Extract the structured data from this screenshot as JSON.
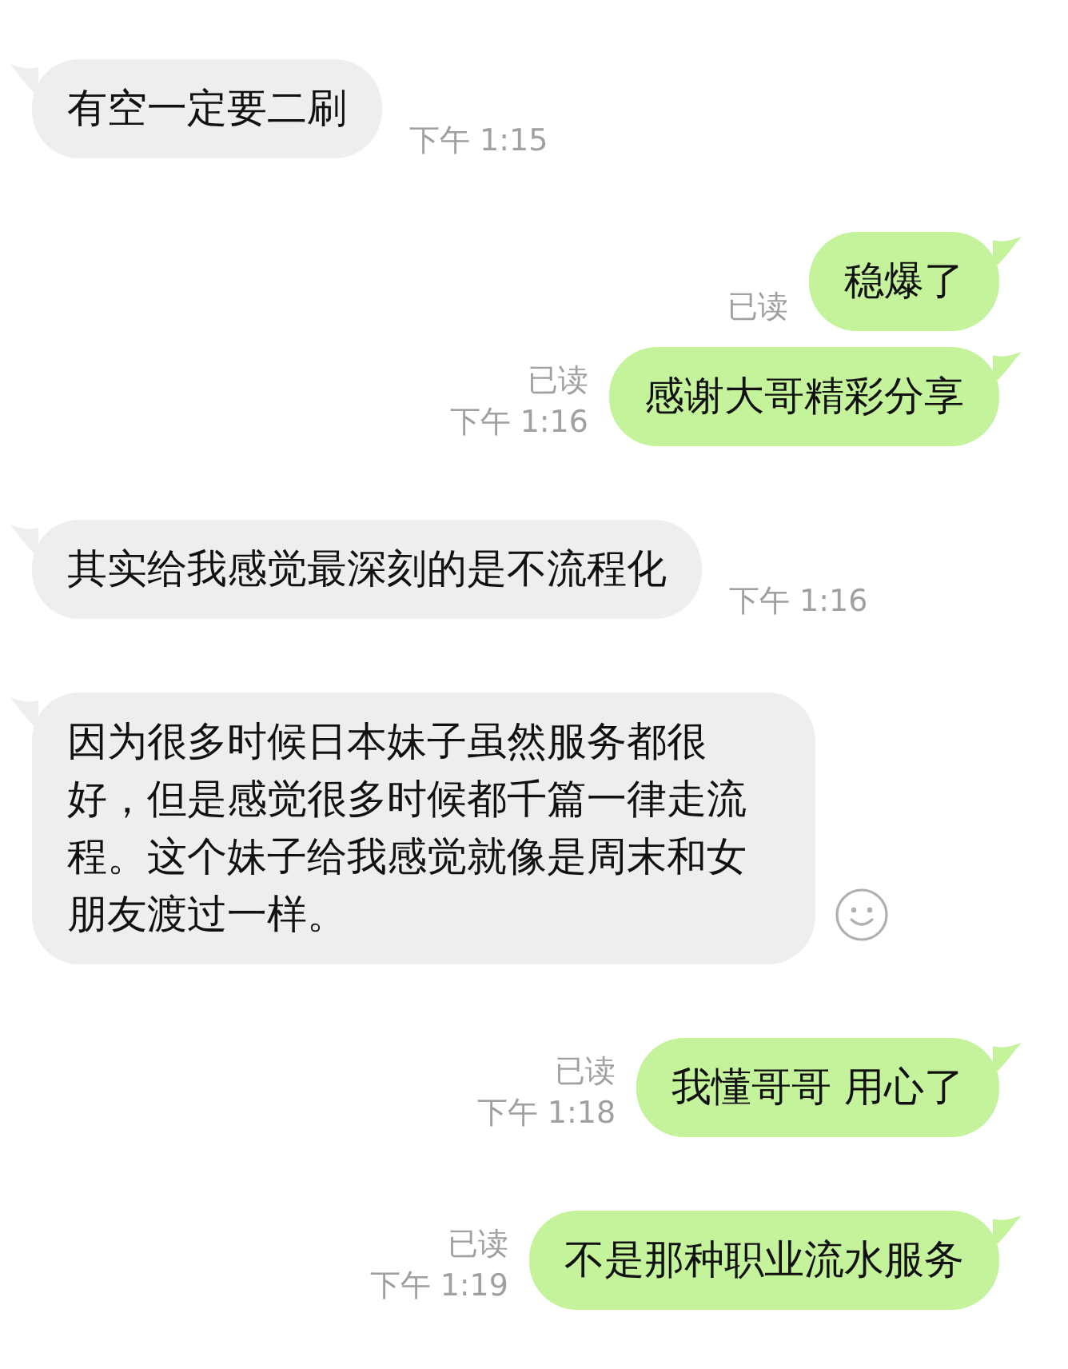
{
  "messages": [
    {
      "kind": "incoming",
      "text": "有空一定要二刷",
      "time": "下午 1:15"
    },
    {
      "kind": "outgoing",
      "text": "稳爆了",
      "read": "已读"
    },
    {
      "kind": "outgoing",
      "text": "感谢大哥精彩分享",
      "read": "已读",
      "time": "下午 1:16"
    },
    {
      "kind": "incoming",
      "text": "其实给我感觉最深刻的是不流程化",
      "time": "下午 1:16"
    },
    {
      "kind": "incoming",
      "text": "因为很多时候日本妹子虽然服务都很好，但是感觉很多时候都千篇一律走流程。这个妹子给我感觉就像是周末和女朋友渡过一样。",
      "reaction_button": true
    },
    {
      "kind": "outgoing",
      "text": "我懂哥哥 用心了",
      "read": "已读",
      "time": "下午 1:18"
    },
    {
      "kind": "outgoing",
      "text": "不是那种职业流水服务",
      "read": "已读",
      "time": "下午 1:19"
    }
  ]
}
